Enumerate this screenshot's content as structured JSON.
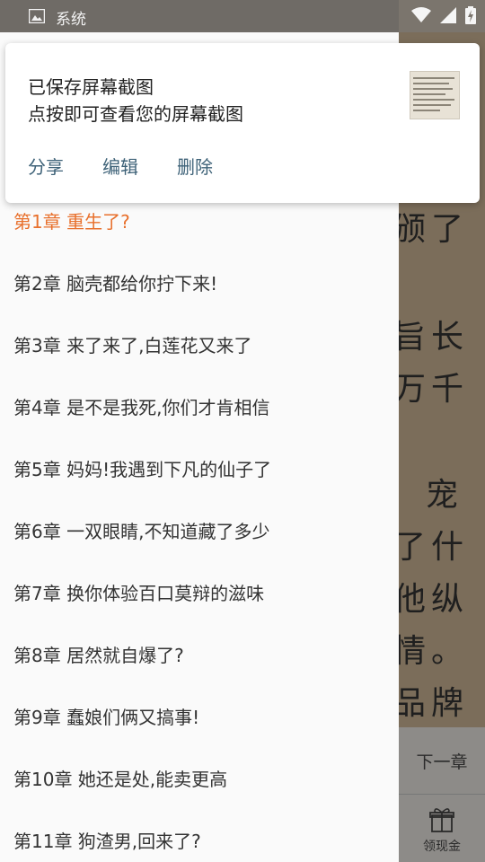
{
  "status_bar": {
    "app_label": "系统",
    "icons": [
      "image-icon",
      "wifi-icon",
      "signal-icon",
      "battery-charging-icon"
    ]
  },
  "notification": {
    "line1": "已保存屏幕截图",
    "line2": "点按即可查看您的屏幕截图",
    "actions": {
      "share": "分享",
      "edit": "编辑",
      "delete": "删除"
    }
  },
  "chapters": [
    {
      "label": "第1章 重生了?",
      "active": true
    },
    {
      "label": "第2章 脑壳都给你拧下来!",
      "active": false
    },
    {
      "label": "第3章 来了来了,白莲花又来了",
      "active": false
    },
    {
      "label": "第4章 是不是我死,你们才肯相信",
      "active": false
    },
    {
      "label": "第5章 妈妈!我遇到下凡的仙子了",
      "active": false
    },
    {
      "label": "第6章 一双眼睛,不知道藏了多少",
      "active": false
    },
    {
      "label": "第7章 换你体验百口莫辩的滋味",
      "active": false
    },
    {
      "label": "第8章 居然就自爆了?",
      "active": false
    },
    {
      "label": "第9章 蠢娘们俩又搞事!",
      "active": false
    },
    {
      "label": "第10章 她还是处,能卖更高",
      "active": false
    },
    {
      "label": "第11章 狗渣男,回来了?",
      "active": false
    }
  ],
  "reader": {
    "lines": [
      "颁了",
      "旨长",
      "万千",
      "宠",
      "了什",
      "他纵",
      "情。",
      "品牌"
    ],
    "next_chapter": "下一章",
    "cash_label": "领现金"
  },
  "colors": {
    "active_chapter": "#e8702c",
    "notification_action": "#3e6278"
  }
}
